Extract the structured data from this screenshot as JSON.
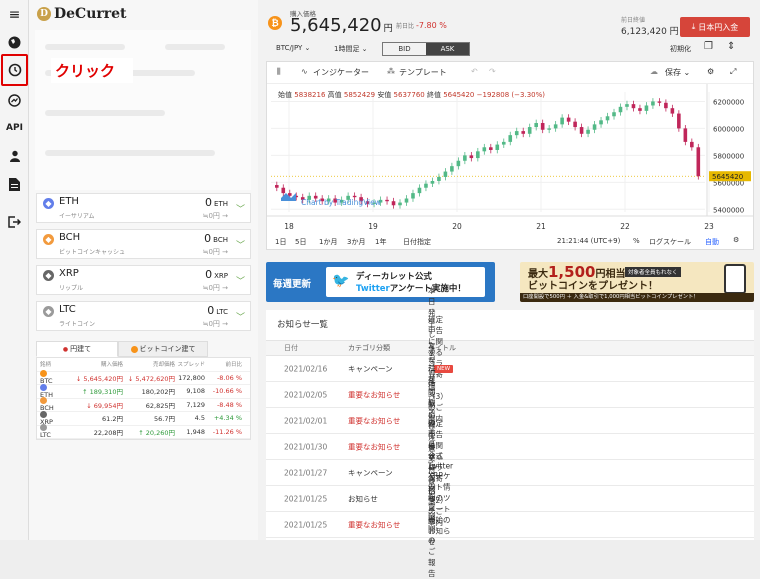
{
  "sidebar": {
    "items": [
      "menu-icon",
      "globe-icon",
      "history-icon",
      "chart-icon",
      "API",
      "user-icon",
      "document-icon",
      "logout-icon"
    ],
    "api_label": "API"
  },
  "annotation": {
    "click_label": "クリック"
  },
  "brand": {
    "name": "DeCurret"
  },
  "coins": [
    {
      "symbol": "ETH",
      "name": "イーサリアム",
      "amount": "0",
      "unit": "ETH",
      "yen": "≒0円",
      "color": "#627eea"
    },
    {
      "symbol": "BCH",
      "name": "ビットコインキャッシュ",
      "amount": "0",
      "unit": "BCH",
      "yen": "≒0円",
      "color": "#f29a3d"
    },
    {
      "symbol": "XRP",
      "name": "リップル",
      "amount": "0",
      "unit": "XRP",
      "yen": "≒0円",
      "color": "#666666"
    },
    {
      "symbol": "LTC",
      "name": "ライトコイン",
      "amount": "0",
      "unit": "LTC",
      "yen": "≒0円",
      "color": "#9a9a9a"
    }
  ],
  "market": {
    "tabs": [
      "円建て",
      "ビットコイン建て"
    ],
    "headers": [
      "銘柄",
      "購入価格",
      "売却価格",
      "スプレッド",
      "前日比"
    ],
    "rows": [
      {
        "sym": "BTC",
        "buy": "↓ 5,645,420円",
        "sell": "↓ 5,472,620円",
        "spread": "172,800",
        "chg": "-8.06 %",
        "buy_dir": "down",
        "sell_dir": "down",
        "chg_dir": "down",
        "color": "#f7931a"
      },
      {
        "sym": "ETH",
        "buy": "↑ 189,310円",
        "sell": "180,202円",
        "spread": "9,108",
        "chg": "-10.66 %",
        "buy_dir": "up",
        "sell_dir": "flat",
        "chg_dir": "down",
        "color": "#627eea"
      },
      {
        "sym": "BCH",
        "buy": "↓ 69,954円",
        "sell": "62,825円",
        "spread": "7,129",
        "chg": "-8.48 %",
        "buy_dir": "down",
        "sell_dir": "flat",
        "chg_dir": "down",
        "color": "#f29a3d"
      },
      {
        "sym": "XRP",
        "buy": "61.2円",
        "sell": "56.7円",
        "spread": "4.5",
        "chg": "+4.34 %",
        "buy_dir": "flat",
        "sell_dir": "flat",
        "chg_dir": "up",
        "color": "#666666"
      },
      {
        "sym": "LTC",
        "buy": "22,208円",
        "sell": "↑ 20,260円",
        "spread": "1,948",
        "chg": "-11.26 %",
        "buy_dir": "flat",
        "sell_dir": "up",
        "chg_dir": "down",
        "color": "#9a9a9a"
      }
    ]
  },
  "header": {
    "price_label": "購入価格",
    "price": "5,645,420",
    "price_unit": "円",
    "change_label": "前日比",
    "change": "-7.80 %",
    "prev_label": "前日終値",
    "prev": "6,123,420 円",
    "deposit": "日本円入金"
  },
  "controls": {
    "pair": "BTC/JPY ⌄",
    "timeframe": "1時間足 ⌄",
    "bid": "BID",
    "ask": "ASK",
    "init": "初期化"
  },
  "chart_toolbar": {
    "indicator": "インジケーター",
    "template": "テンプレート",
    "save": "保存 ⌄"
  },
  "chart_legend": {
    "open_l": "始值",
    "open": "5838216",
    "high_l": "高值",
    "high": "5852429",
    "low_l": "安值",
    "low": "5637760",
    "close_l": "終值",
    "close": "5645420",
    "change": "−192808 (−3.30%)"
  },
  "chart_data": {
    "type": "candlestick",
    "x_ticks": [
      "18",
      "19",
      "20",
      "21",
      "22",
      "23"
    ],
    "y_ticks": [
      5400000,
      5600000,
      5800000,
      6000000,
      6200000
    ],
    "ylim": [
      5380000,
      6270000
    ],
    "last_price": 5645420,
    "last_label": "5645420",
    "watermark": "Chart by TradingView",
    "close_series": [
      5560000,
      5520000,
      5500000,
      5490000,
      5470000,
      5500000,
      5480000,
      5460000,
      5480000,
      5450000,
      5470000,
      5500000,
      5490000,
      5460000,
      5440000,
      5450000,
      5470000,
      5460000,
      5430000,
      5450000,
      5480000,
      5520000,
      5560000,
      5590000,
      5610000,
      5640000,
      5680000,
      5720000,
      5760000,
      5800000,
      5780000,
      5830000,
      5860000,
      5840000,
      5880000,
      5900000,
      5950000,
      5980000,
      5960000,
      6010000,
      6040000,
      5990000,
      6000000,
      6030000,
      6080000,
      6050000,
      6010000,
      5960000,
      5990000,
      6030000,
      6060000,
      6090000,
      6120000,
      6160000,
      6180000,
      6150000,
      6130000,
      6170000,
      6200000,
      6190000,
      6150000,
      6110000,
      6000000,
      5900000,
      5860000,
      5645420
    ]
  },
  "chart_bottom": {
    "ranges": [
      "1日",
      "5日",
      "1か月",
      "3か月",
      "1年",
      "日付指定"
    ],
    "time": "21:21:44 (UTC+9)",
    "percent": "%",
    "log": "ログスケール",
    "auto": "自動"
  },
  "banners": {
    "b1_left": "毎週更新",
    "b1_line1": "ディーカレット公式",
    "b1_line2_a": "Twitter",
    "b1_line2_b": "アンケート実施中！",
    "b2_line1": "最大",
    "b2_amount": "1,500",
    "b2_line1b": "円相当",
    "b2_line2": "ビットコインをプレゼント！",
    "b2_tag": "対象者全員もれなく",
    "b2_strip": "口座開設で500円 ＋ 入金&取引で1,000円相当ビットコインプレゼント！"
  },
  "news": {
    "title": "お知らせ一覧",
    "headers": [
      "日付",
      "カテゴリ分類",
      "タイトル"
    ],
    "rows": [
      {
        "date": "2021/02/16",
        "cat": "キャンペーン",
        "title": "確定申告に関するコラム寄稿（3）のご案内",
        "important": false,
        "new": "NEW"
      },
      {
        "date": "2021/02/05",
        "cat": "重要なお知らせ",
        "title": "本日発生した当社サービスの不具合について",
        "important": true,
        "new": ""
      },
      {
        "date": "2021/02/01",
        "cat": "重要なお知らせ",
        "title": "急な価格変動にご注意ください",
        "important": true,
        "new": ""
      },
      {
        "date": "2021/01/30",
        "cat": "重要なお知らせ",
        "title": "年間取引報告書交付のご案内",
        "important": true,
        "new": ""
      },
      {
        "date": "2021/01/27",
        "cat": "キャンペーン",
        "title": "確定申告に関するコラム寄稿（2）のご案内",
        "important": false,
        "new": ""
      },
      {
        "date": "2021/01/25",
        "cat": "お知らせ",
        "title": "公式Twitter マーケット情報のツイート開始のお知らせ",
        "important": false,
        "new": ""
      },
      {
        "date": "2021/01/25",
        "cat": "重要なお知らせ",
        "title": "XRPの売買再開のご報告",
        "important": true,
        "new": ""
      }
    ]
  }
}
